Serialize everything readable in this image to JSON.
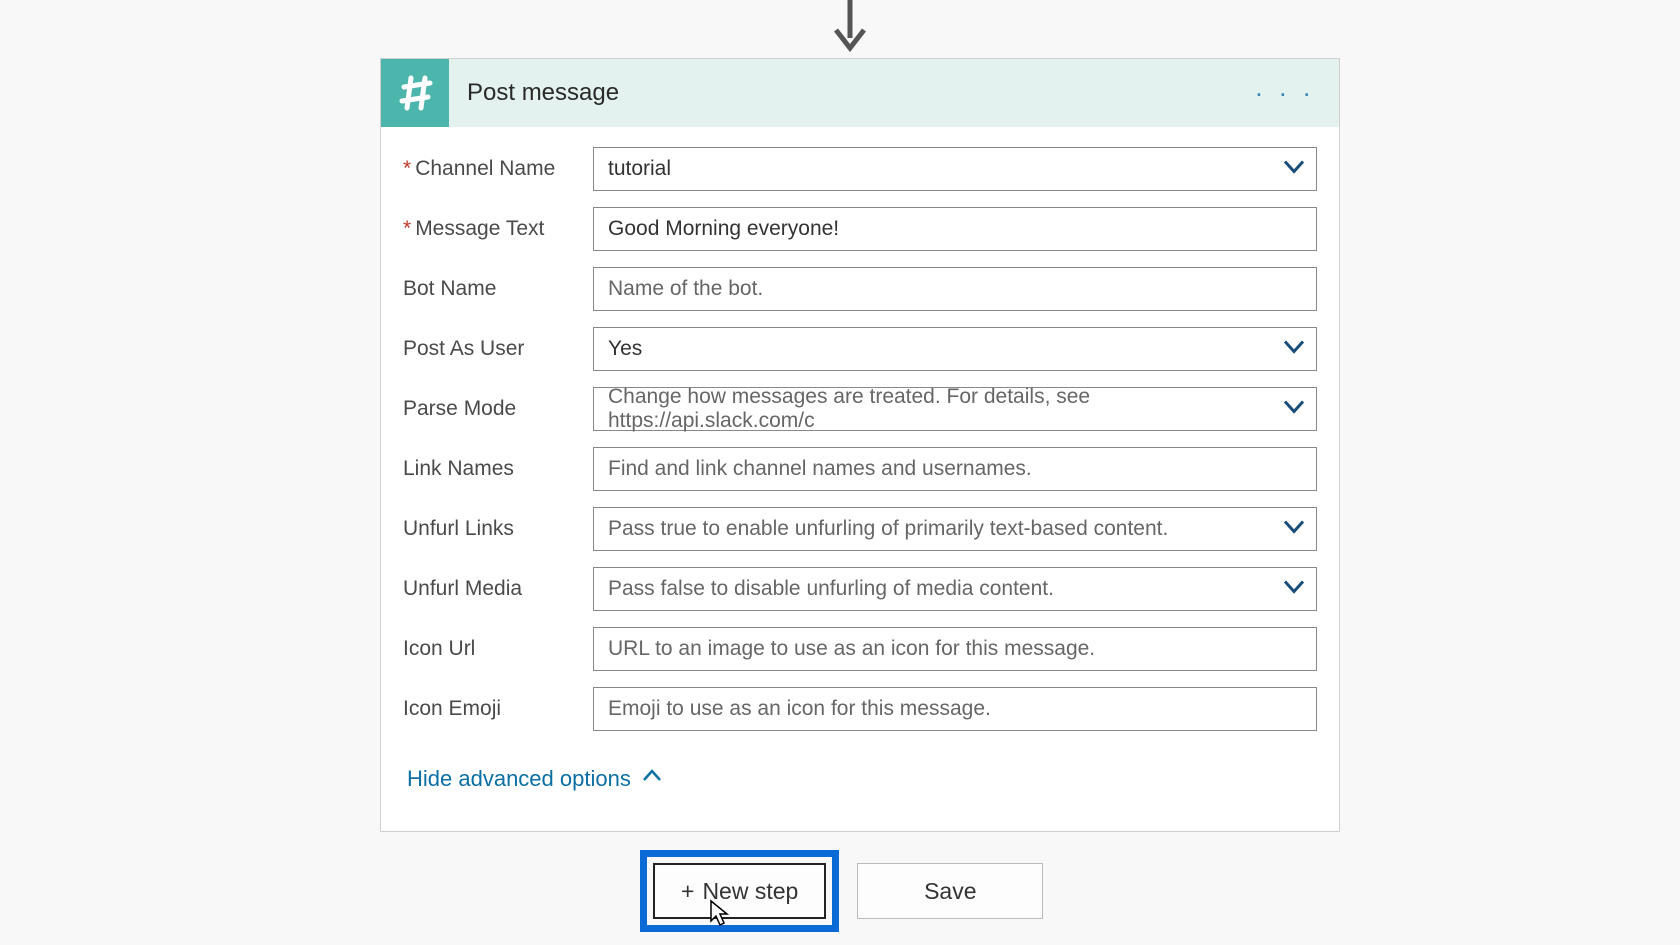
{
  "card": {
    "title": "Post message",
    "advanced_toggle": "Hide advanced options"
  },
  "fields": {
    "channel": {
      "label": "Channel Name",
      "required": true,
      "value": "tutorial",
      "dropdown": true
    },
    "message": {
      "label": "Message Text",
      "required": true,
      "value": "Good Morning everyone!",
      "dropdown": false
    },
    "bot_name": {
      "label": "Bot Name",
      "required": false,
      "placeholder": "Name of the bot.",
      "dropdown": false
    },
    "post_as_user": {
      "label": "Post As User",
      "required": false,
      "value": "Yes",
      "dropdown": true
    },
    "parse_mode": {
      "label": "Parse Mode",
      "required": false,
      "placeholder": "Change how messages are treated. For details, see https://api.slack.com/c",
      "dropdown": true
    },
    "link_names": {
      "label": "Link Names",
      "required": false,
      "placeholder": "Find and link channel names and usernames.",
      "dropdown": false
    },
    "unfurl_links": {
      "label": "Unfurl Links",
      "required": false,
      "placeholder": "Pass true to enable unfurling of primarily text-based content.",
      "dropdown": true
    },
    "unfurl_media": {
      "label": "Unfurl Media",
      "required": false,
      "placeholder": "Pass false to disable unfurling of media content.",
      "dropdown": true
    },
    "icon_url": {
      "label": "Icon Url",
      "required": false,
      "placeholder": "URL to an image to use as an icon for this message.",
      "dropdown": false
    },
    "icon_emoji": {
      "label": "Icon Emoji",
      "required": false,
      "placeholder": "Emoji to use as an icon for this message.",
      "dropdown": false
    }
  },
  "buttons": {
    "new_step": "New step",
    "save": "Save"
  },
  "colors": {
    "slack_bg": "#4db6ac",
    "highlight": "#0a6ad6",
    "link": "#0b6fa4"
  }
}
